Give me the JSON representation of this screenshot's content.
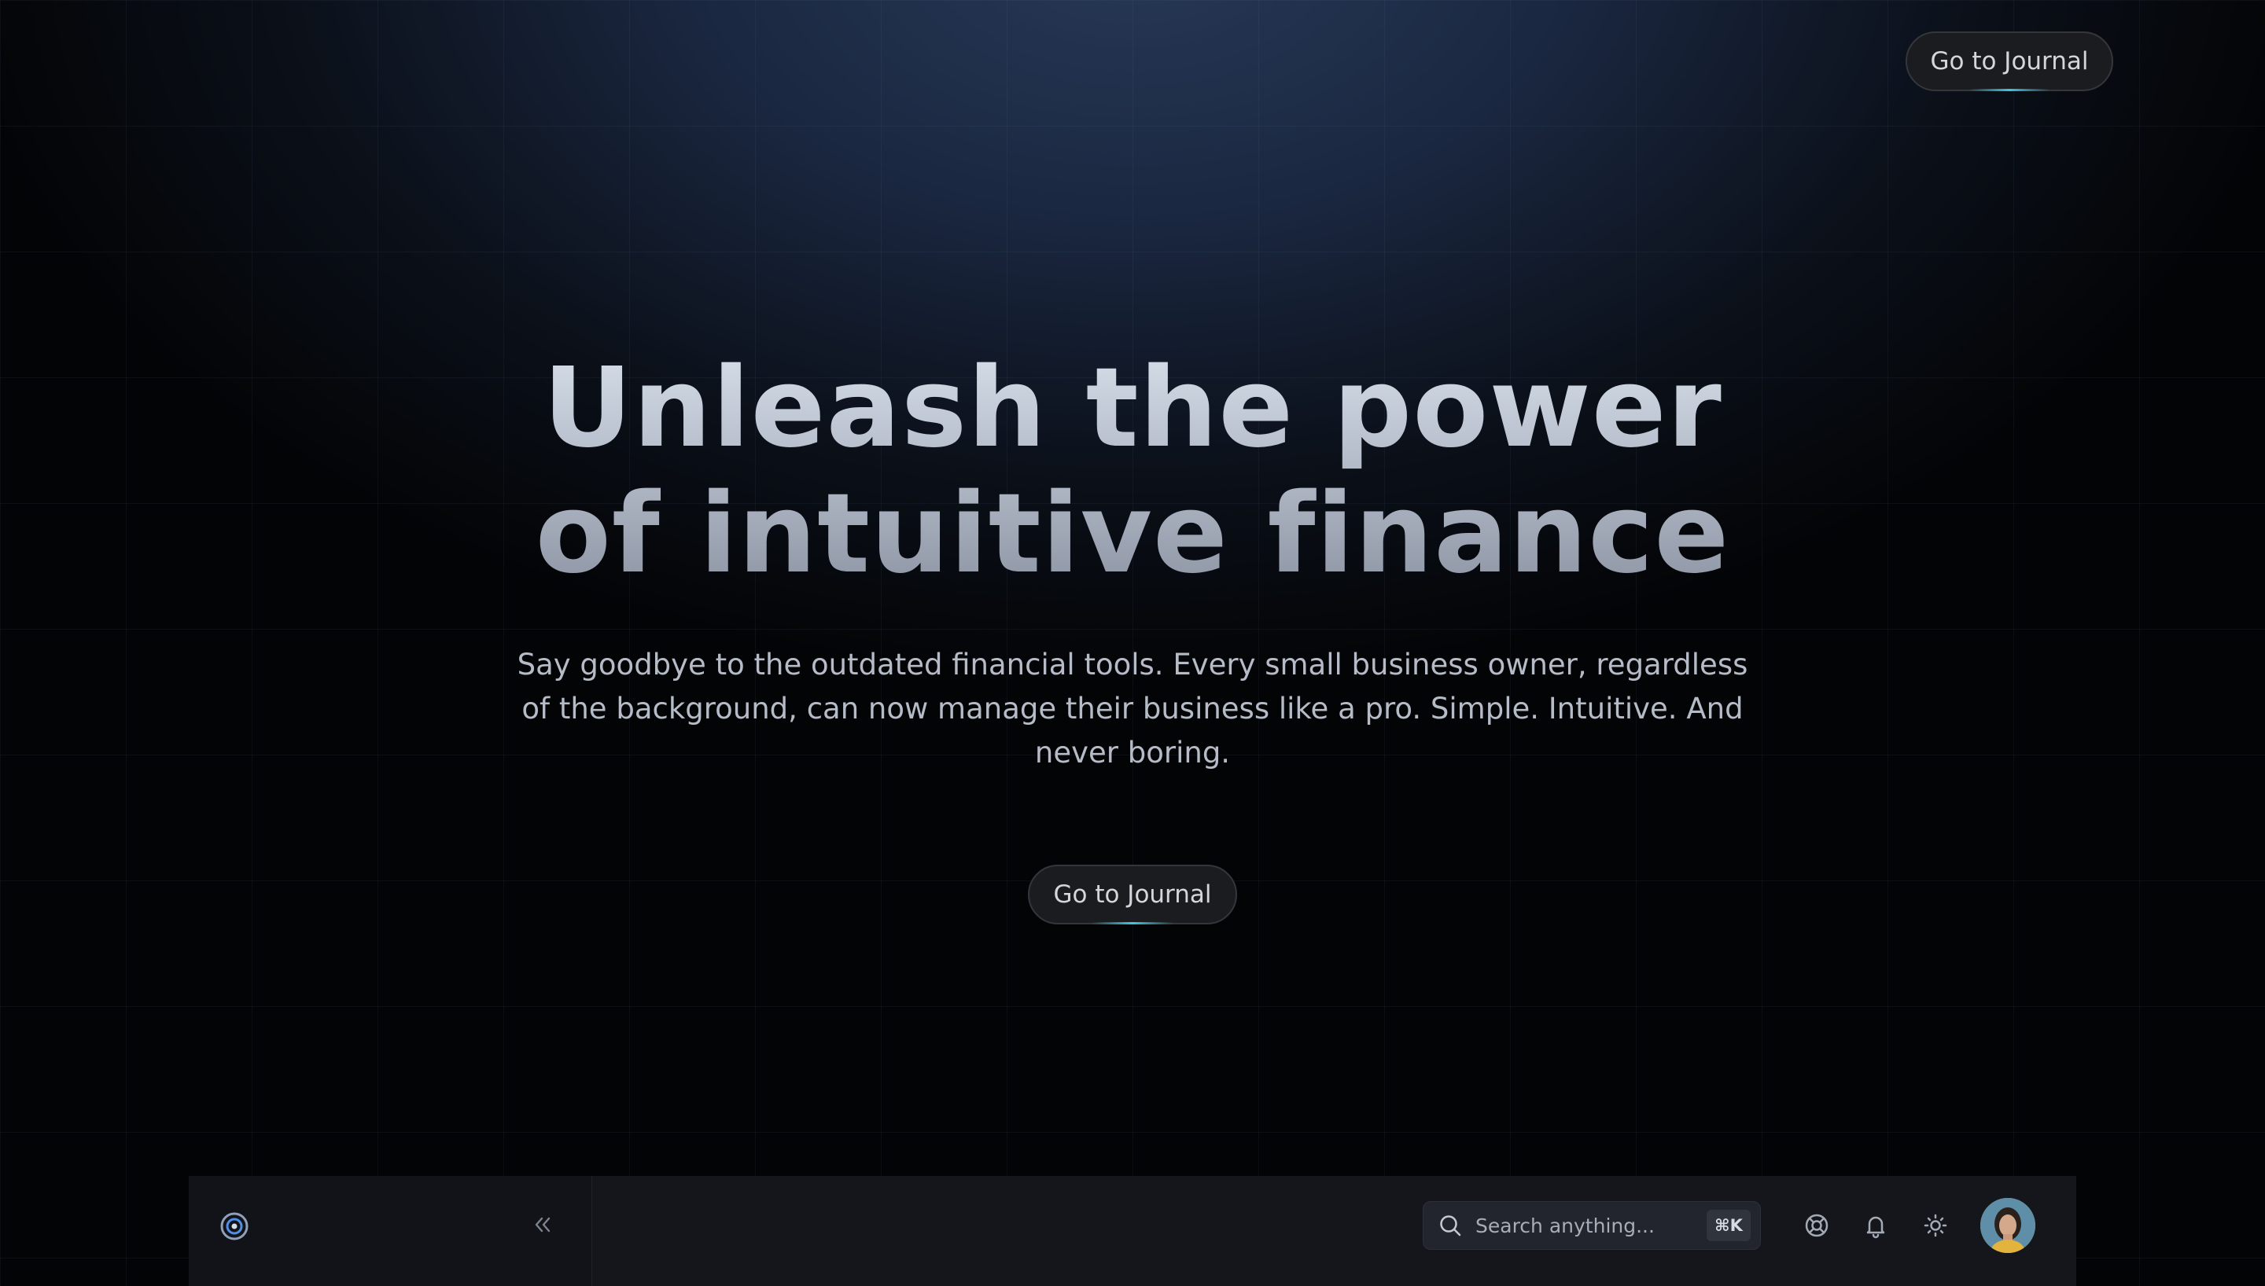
{
  "header": {
    "cta_label": "Go to Journal"
  },
  "hero": {
    "title_line1": "Unleash the power",
    "title_line2": "of intuitive finance",
    "subtitle": "Say goodbye to the outdated financial tools. Every small business owner, regardless of the background, can now manage their business like a pro. Simple. Intuitive. And never boring.",
    "cta_label": "Go to Journal"
  },
  "app_bar": {
    "logo_icon": "target-logo-icon",
    "collapse_icon": "double-chevron-left-icon",
    "search": {
      "placeholder": "Search anything...",
      "shortcut": "⌘K"
    },
    "icons": [
      "lifebuoy-icon",
      "bell-icon",
      "sun-icon"
    ],
    "avatar": "user-avatar"
  },
  "colors": {
    "accent": "#3ec7e0",
    "background_top": "#283a58",
    "background_bottom": "#030406"
  }
}
